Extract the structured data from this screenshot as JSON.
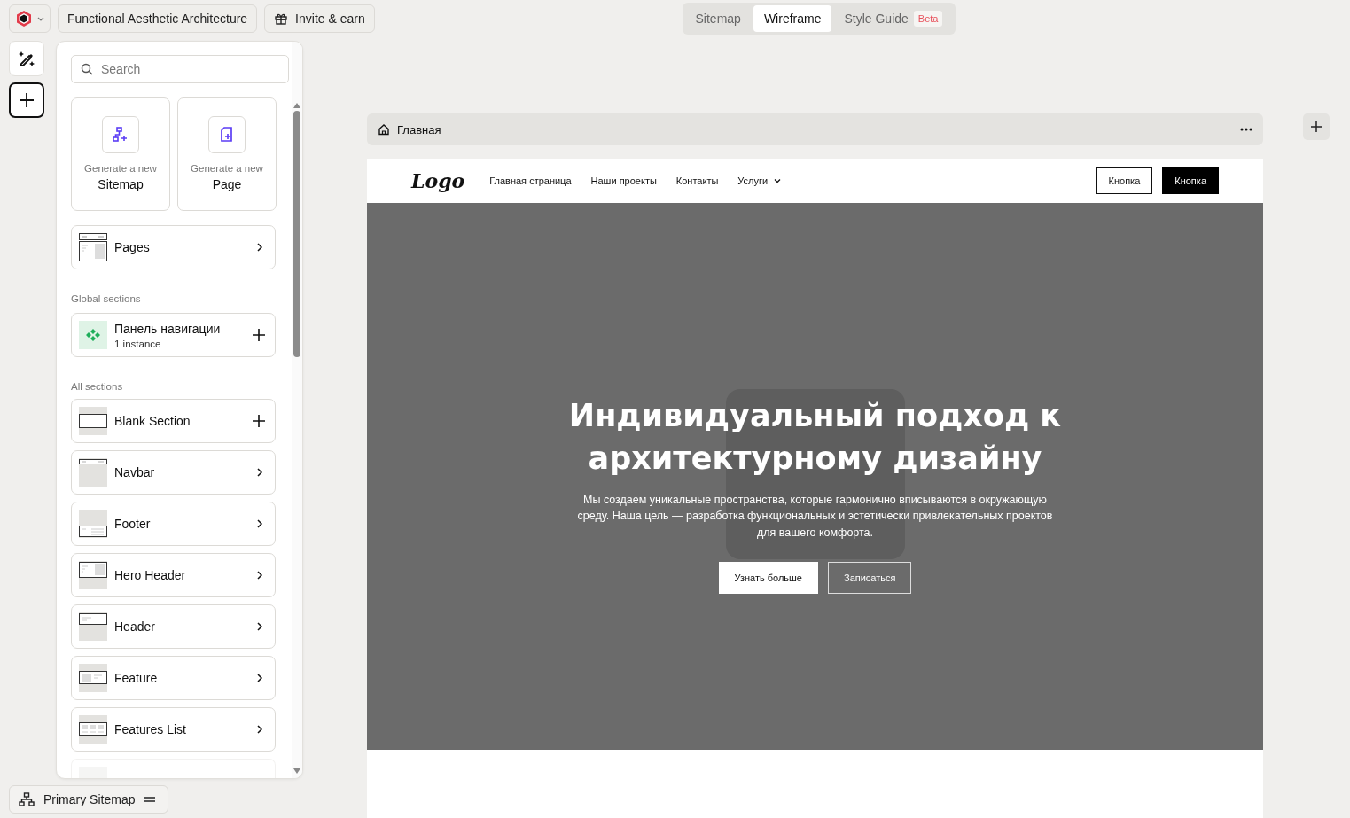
{
  "topbar": {
    "project": "Functional Aesthetic Architecture",
    "invite": "Invite & earn"
  },
  "tabs": [
    {
      "label": "Sitemap",
      "selected": false
    },
    {
      "label": "Wireframe",
      "selected": true
    },
    {
      "label": "Style Guide",
      "selected": false,
      "badge": "Beta"
    }
  ],
  "sidebar": {
    "search": {
      "placeholder": "Search"
    },
    "generate": [
      {
        "kind": "sitemap",
        "caption": "Generate a new",
        "label": "Sitemap"
      },
      {
        "kind": "page",
        "caption": "Generate a new",
        "label": "Page"
      }
    ],
    "pages": {
      "label": "Pages"
    },
    "global_heading": "Global sections",
    "global_sections": [
      {
        "label": "Панель навигации",
        "meta": "1 instance"
      }
    ],
    "all_heading": "All sections",
    "sections": [
      {
        "kind": "blank",
        "label": "Blank Section",
        "addable": true
      },
      {
        "kind": "navbar",
        "label": "Navbar",
        "addable": false
      },
      {
        "kind": "footer",
        "label": "Footer",
        "addable": false
      },
      {
        "kind": "hero",
        "label": "Hero Header",
        "addable": false
      },
      {
        "kind": "header",
        "label": "Header",
        "addable": false
      },
      {
        "kind": "feature",
        "label": "Feature",
        "addable": false
      },
      {
        "kind": "features-list",
        "label": "Features List",
        "addable": false
      }
    ]
  },
  "sitemap_button": "Primary Sitemap",
  "frame": {
    "title": "Главная",
    "nav": {
      "logo": "Logo",
      "links": [
        {
          "label": "Главная страница",
          "dropdown": false
        },
        {
          "label": "Наши проекты",
          "dropdown": false
        },
        {
          "label": "Контакты",
          "dropdown": false
        },
        {
          "label": "Услуги",
          "dropdown": true
        }
      ],
      "buttons": [
        {
          "label": "Кнопка",
          "kind": "outline"
        },
        {
          "label": "Кнопка",
          "kind": "solid"
        }
      ]
    },
    "hero": {
      "title_lines": [
        "Индивидуальный подход к",
        "архитектурному дизайну"
      ],
      "text": "Мы создаем уникальные пространства, которые гармонично вписываются в окружающую среду. Наша цель — разработка функциональных и эстетически привлекательных проектов для вашего комфорта.",
      "buttons": [
        {
          "label": "Узнать больше",
          "kind": "solid"
        },
        {
          "label": "Записаться",
          "kind": "outline"
        }
      ]
    }
  }
}
